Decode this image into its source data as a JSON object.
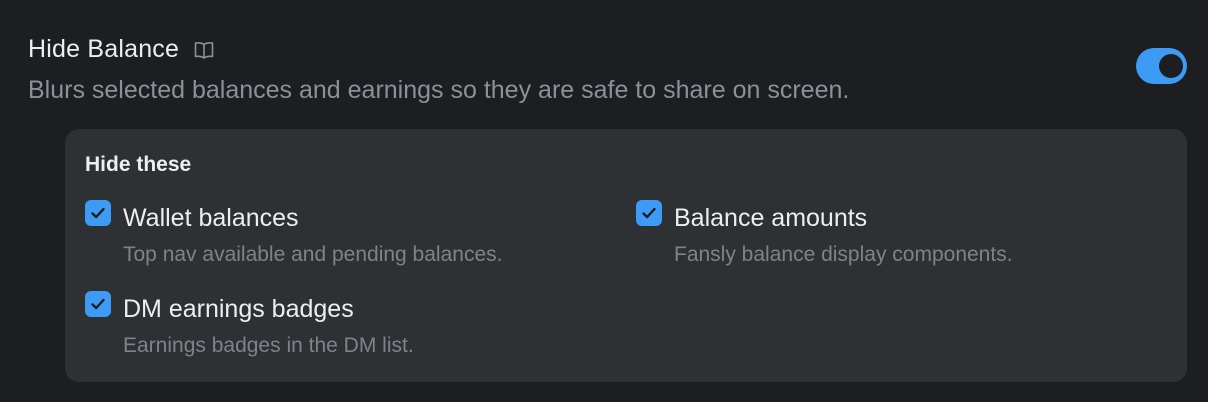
{
  "setting": {
    "title": "Hide Balance",
    "description": "Blurs selected balances and earnings so they are safe to share on screen.",
    "enabled": true,
    "icon": "book-icon",
    "accent_color": "#3e9bf5"
  },
  "panel": {
    "title": "Hide these",
    "options": [
      {
        "label": "Wallet balances",
        "description": "Top nav available and pending balances.",
        "checked": true
      },
      {
        "label": "Balance amounts",
        "description": "Fansly balance display components.",
        "checked": true
      },
      {
        "label": "DM earnings badges",
        "description": "Earnings badges in the DM list.",
        "checked": true
      }
    ]
  }
}
